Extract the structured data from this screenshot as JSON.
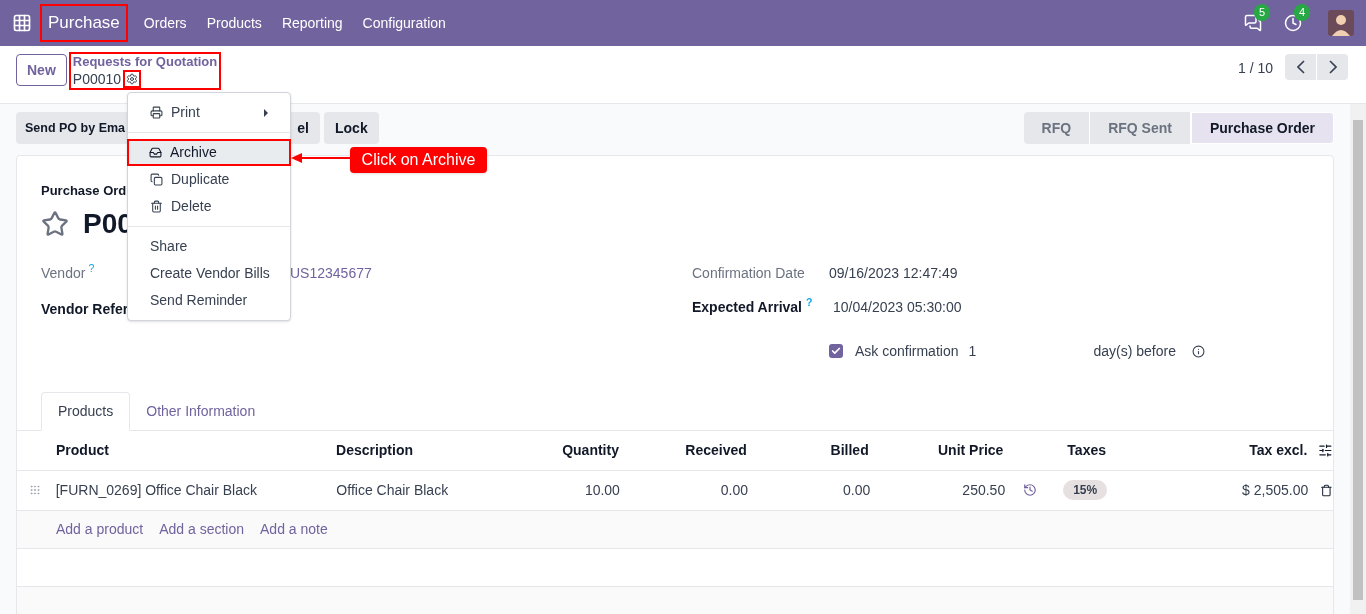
{
  "navbar": {
    "app": "Purchase",
    "app_highlighted": true,
    "menu": [
      "Orders",
      "Products",
      "Reporting",
      "Configuration"
    ],
    "messages_badge": "5",
    "activities_badge": "4"
  },
  "control_panel": {
    "new_button": "New",
    "breadcrumb": "Requests for Quotation",
    "record": "P00010",
    "breadcrumb_highlighted": true,
    "gear_highlighted": true,
    "pager": "1 / 10"
  },
  "actions": {
    "buttons": [
      "Send PO by Ema",
      "el",
      "Lock"
    ]
  },
  "statusbar": [
    {
      "label": "RFQ",
      "selected": false
    },
    {
      "label": "RFQ Sent",
      "selected": false
    },
    {
      "label": "Purchase Order",
      "selected": true
    }
  ],
  "gear_menu": {
    "groups": [
      [
        {
          "label": "Print",
          "selected": false
        }
      ],
      [
        {
          "label": "Archive",
          "selected": true
        },
        {
          "label": "Duplicate",
          "selected": false
        },
        {
          "label": "Delete",
          "selected": false
        }
      ],
      [
        {
          "label": "Share",
          "selected": false
        },
        {
          "label": "Create Vendor Bills",
          "selected": false
        },
        {
          "label": "Send Reminder",
          "selected": false
        }
      ]
    ]
  },
  "callout": "Click on Archive",
  "form": {
    "title_label": "Purchase Ord",
    "title": "P00",
    "starred": false,
    "vendor_label": "Vendor",
    "help_mark": "?",
    "vendor_value": "US12345677",
    "vendor_ref_label": "Vendor Refer",
    "confirmation_label": "Confirmation Date",
    "confirmation_value": "09/16/2023 12:47:49",
    "arrival_label": "Expected Arrival",
    "arrival_value": "10/04/2023 05:30:00",
    "ask_confirmation": {
      "checked": true,
      "label": "Ask confirmation",
      "days": "1",
      "suffix": "day(s) before"
    }
  },
  "tabs": [
    {
      "label": "Products",
      "selected": true
    },
    {
      "label": "Other Information",
      "selected": false
    }
  ],
  "table": {
    "columns": [
      "Product",
      "Description",
      "Quantity",
      "Received",
      "Billed",
      "Unit Price",
      "Taxes",
      "Tax excl."
    ],
    "rows": [
      {
        "product": "[FURN_0269] Office Chair Black",
        "description": "Office Chair Black",
        "quantity": "10.00",
        "received": "0.00",
        "billed": "0.00",
        "unit_price": "250.50",
        "taxes": "15%",
        "tax_excl": "$ 2,505.00"
      }
    ],
    "add_links": [
      "Add a product",
      "Add a section",
      "Add a note"
    ]
  }
}
